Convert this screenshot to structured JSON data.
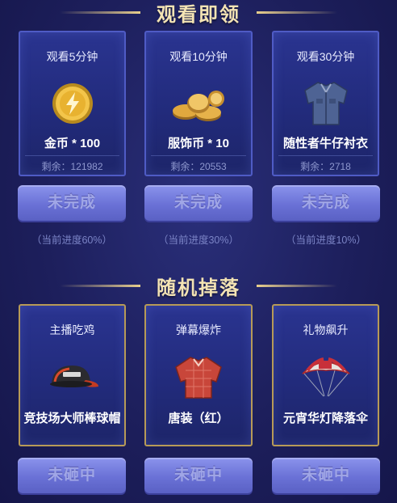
{
  "sections": [
    {
      "title": "观看即领",
      "cards": [
        {
          "title": "观看5分钟",
          "item": "金币 * 100",
          "remaining": "剩余：121982",
          "button": "未完成",
          "progress": "（当前进度60%）",
          "icon": "gold-coin-icon"
        },
        {
          "title": "观看10分钟",
          "item": "服饰币 * 10",
          "remaining": "剩余：20553",
          "button": "未完成",
          "progress": "（当前进度30%）",
          "icon": "coin-pile-icon"
        },
        {
          "title": "观看30分钟",
          "item": "随性者牛仔衬衣",
          "remaining": "剩余：2718",
          "button": "未完成",
          "progress": "（当前进度10%）",
          "icon": "denim-shirt-icon"
        }
      ]
    },
    {
      "title": "随机掉落",
      "cards": [
        {
          "title": "主播吃鸡",
          "item": "竞技场大师棒球帽",
          "button": "未砸中",
          "icon": "baseball-cap-icon"
        },
        {
          "title": "弹幕爆炸",
          "item": "唐装（红）",
          "button": "未砸中",
          "icon": "red-jacket-icon"
        },
        {
          "title": "礼物飙升",
          "item": "元宵华灯降落伞",
          "button": "未砸中",
          "icon": "parachute-icon"
        }
      ]
    }
  ],
  "colors": {
    "accent_gold": "#e9cf8c",
    "card_border_blue": "#4f5bc5",
    "card_border_gold": "#b79a57",
    "button": "#6a71d6"
  }
}
